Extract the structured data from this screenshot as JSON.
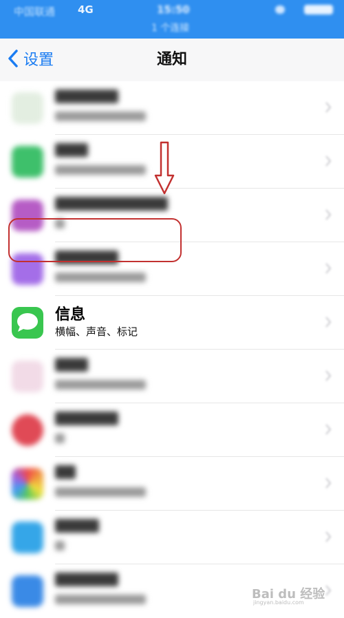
{
  "status_bar": {
    "carrier": "中国联通",
    "network": "4G",
    "time": "15:50",
    "subtitle": "1 个连接"
  },
  "nav": {
    "back_label": "设置",
    "title": "通知"
  },
  "apps": [
    {
      "icon": "app-icon-blurred",
      "color": "#d8e8d6"
    },
    {
      "icon": "wechat-icon",
      "color": "#3ec06b"
    },
    {
      "icon": "game-app-icon",
      "color": "#c65ec2"
    },
    {
      "icon": "purple-app-icon",
      "color": "#a46ee8"
    },
    {
      "icon": "messages-icon",
      "color": "#39c64f",
      "title": "信息",
      "subtitle": "横幅、声音、标记"
    },
    {
      "icon": "music-icon",
      "color": "#f1d7e4"
    },
    {
      "icon": "bank-app-icon",
      "color": "#e04a56"
    },
    {
      "icon": "photos-icon",
      "color": "#f0a040"
    },
    {
      "icon": "alipay-icon",
      "color": "#35a6e8"
    },
    {
      "icon": "blue-app-icon",
      "color": "#3a8ae6"
    }
  ],
  "watermark": {
    "text": "Bai du 经验",
    "url": "jingyan.baidu.com"
  },
  "colors": {
    "status_bar": "#2f8ff0",
    "accent": "#1a7cf2",
    "highlight": "#c2302f"
  }
}
